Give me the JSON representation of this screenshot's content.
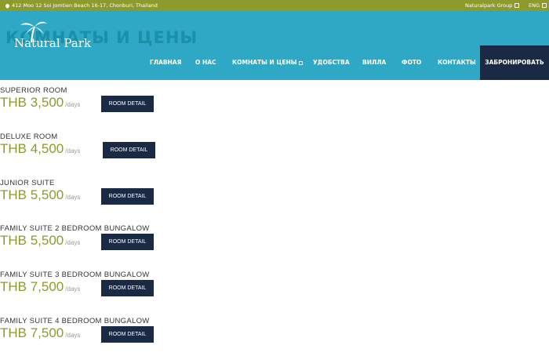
{
  "topbar": {
    "address": "412 Moo 12 Soi Jomtien Beach 16-17, Chonburi, Thailand",
    "address_icon": "map-pin-icon",
    "group": "Naturalpark Group",
    "lang": "ENG"
  },
  "colors": {
    "topbar": "#8e9a2c",
    "header": "#2ea8c4",
    "dark": "#1b2a44",
    "price": "#8e9a2c"
  },
  "header": {
    "page_title": "КОМНАТЫ И ЦЕНЫ",
    "logo_text": "Natural Park",
    "logo_icon": "palm-tree-icon"
  },
  "nav": {
    "items": [
      {
        "label": "ГЛАВНАЯ"
      },
      {
        "label": "О НАС"
      },
      {
        "label": "КОМНАТЫ И ЦЕНЫ"
      },
      {
        "label": "УДОБСТВА"
      },
      {
        "label": "ВИЛЛА"
      },
      {
        "label": "ФОТО"
      },
      {
        "label": "КОНТАКТЫ"
      }
    ],
    "book": "ЗАБРОНИРОВАТЬ"
  },
  "rooms": [
    {
      "name": "SUPERIOR ROOM",
      "price": "THB 3,500",
      "unit": "/days",
      "button": "ROOM DETAIL"
    },
    {
      "name": "DELUXE ROOM",
      "price": "THB 4,500",
      "unit": "/days",
      "button": "ROOM DETAIL"
    },
    {
      "name": "JUNIOR SUITE",
      "price": "THB 5,500",
      "unit": "/days",
      "button": "ROOM DETAIL"
    },
    {
      "name": "FAMILY SUITE 2 BEDROOM BUNGALOW",
      "price": "THB 5,500",
      "unit": "/days",
      "button": "ROOM DETAIL"
    },
    {
      "name": "FAMILY SUITE 3 BEDROOM BUNGALOW",
      "price": "THB 7,500",
      "unit": "/days",
      "button": "ROOM DETAIL"
    },
    {
      "name": "FAMILY SUITE 4 BEDROOM BUNGALOW",
      "price": "THB 7,500",
      "unit": "/days",
      "button": "ROOM DETAIL"
    }
  ]
}
